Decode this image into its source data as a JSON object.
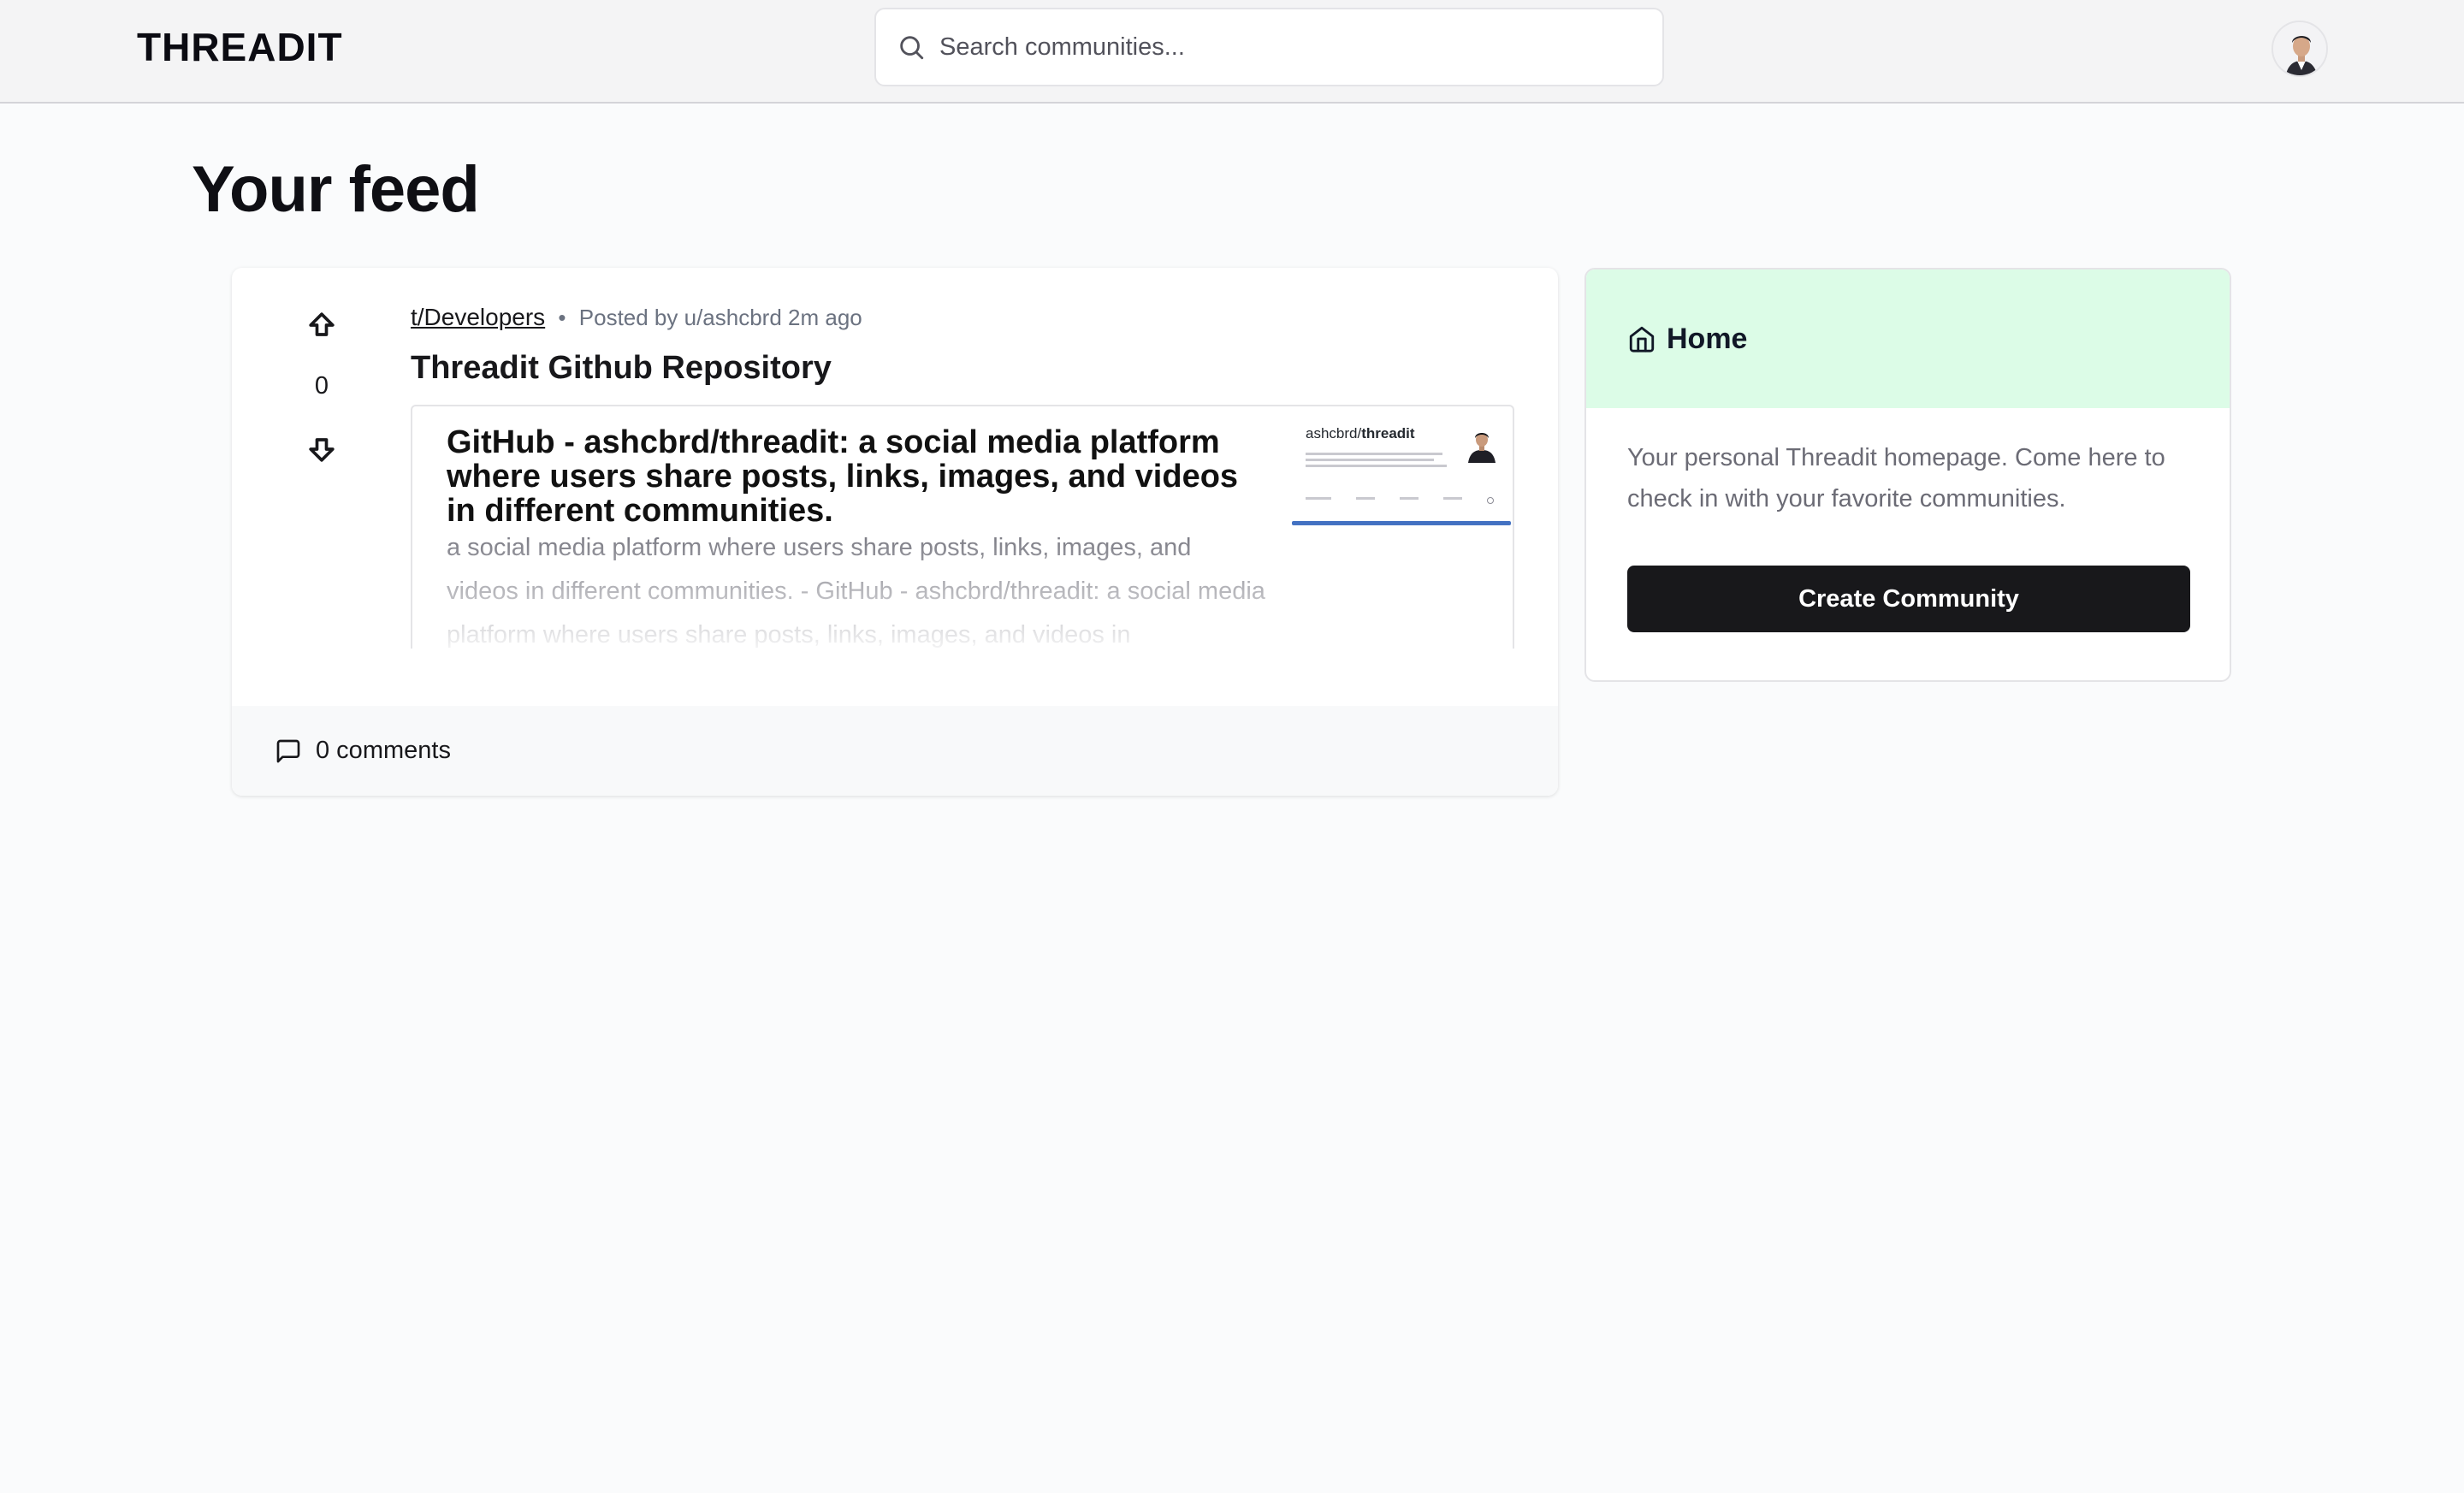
{
  "header": {
    "logo": "THREADIT",
    "search_placeholder": "Search communities..."
  },
  "page": {
    "title": "Your feed"
  },
  "post": {
    "community": "t/Developers",
    "separator": "•",
    "posted_by": "Posted by u/ashcbrd 2m ago",
    "votes": "0",
    "title": "Threadit Github Repository",
    "preview": {
      "title": "GitHub - ashcbrd/threadit: a social media platform where users share posts, links, images, and videos in different communities.",
      "description": "a social media platform where users share posts, links, images, and videos in different communities. - GitHub - ashcbrd/threadit: a social media platform where users share posts, links, images, and videos in",
      "thumb_owner": "ashcbrd/",
      "thumb_repo": "threadit"
    },
    "comments": "0 comments"
  },
  "sidebar": {
    "heading": "Home",
    "description": "Your personal Threadit homepage. Come here to check in with your favorite communities.",
    "button": "Create Community",
    "accent": "#dcfce7"
  },
  "icons": {
    "search": "search-icon",
    "upvote": "arrow-big-up-icon",
    "downvote": "arrow-big-down-icon",
    "comment": "message-square-icon",
    "home": "home-icon"
  }
}
